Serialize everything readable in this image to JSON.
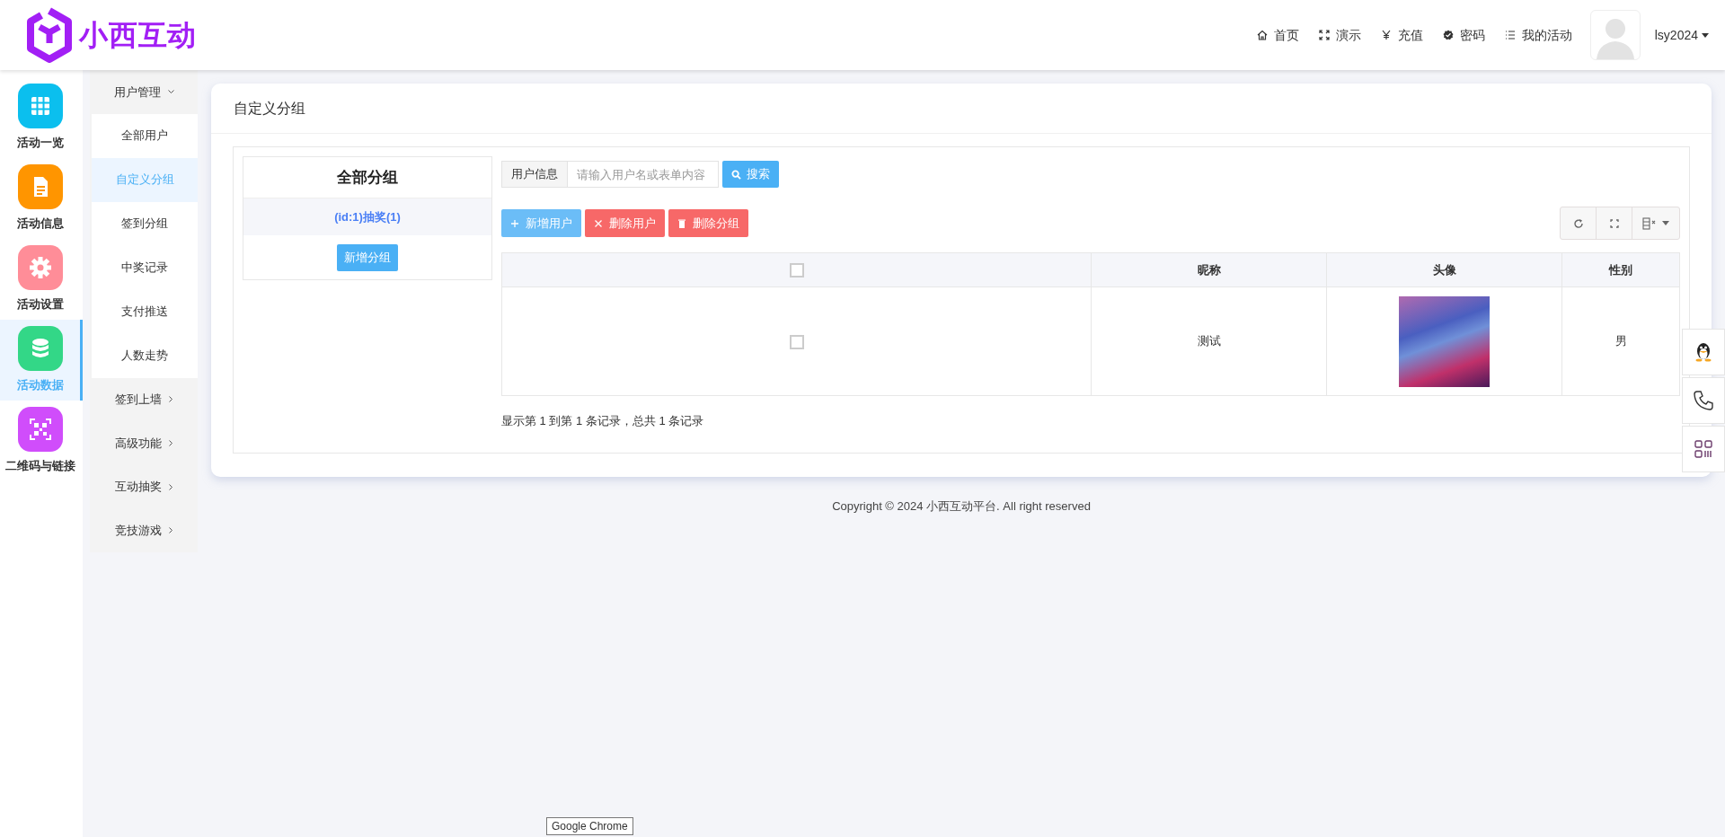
{
  "brand": {
    "name": "小西互动"
  },
  "top_nav": [
    {
      "kind": "home",
      "label": "首页"
    },
    {
      "kind": "expand",
      "label": "演示"
    },
    {
      "kind": "yen",
      "label": "充值"
    },
    {
      "kind": "badge",
      "label": "密码"
    },
    {
      "kind": "list",
      "label": "我的活动"
    }
  ],
  "user": {
    "name": "lsy2024"
  },
  "sidebar": {
    "items": [
      {
        "kind": "grid",
        "label": "活动一览",
        "color": "#0bbfee",
        "selected": false
      },
      {
        "kind": "doc",
        "label": "活动信息",
        "color": "#ff9500",
        "selected": false
      },
      {
        "kind": "gear",
        "label": "活动设置",
        "color": "#ff8d98",
        "selected": false
      },
      {
        "kind": "db",
        "label": "活动数据",
        "color": "#33d787",
        "selected": true
      },
      {
        "kind": "qr",
        "label": "二维码与链接",
        "color": "#d04dfb",
        "selected": false
      }
    ]
  },
  "submenu": [
    {
      "label": "用户管理",
      "expanded": true,
      "children": [
        {
          "label": "全部用户",
          "selected": false
        },
        {
          "label": "自定义分组",
          "selected": true
        },
        {
          "label": "签到分组",
          "selected": false
        },
        {
          "label": "中奖记录",
          "selected": false
        },
        {
          "label": "支付推送",
          "selected": false
        },
        {
          "label": "人数走势",
          "selected": false
        }
      ]
    },
    {
      "label": "签到上墙",
      "expanded": false
    },
    {
      "label": "高级功能",
      "expanded": false
    },
    {
      "label": "互动抽奖",
      "expanded": false
    },
    {
      "label": "竞技游戏",
      "expanded": false
    }
  ],
  "page_title": "自定义分组",
  "groups": {
    "title": "全部分组",
    "items": [
      {
        "label": "(id:1)抽奖(1)",
        "selected": true
      }
    ],
    "add_button": "新增分组"
  },
  "search": {
    "label": "用户信息",
    "placeholder": "请输入用户名或表单内容",
    "button": "搜索"
  },
  "actions": [
    {
      "kind": "add",
      "label": "新增用户"
    },
    {
      "kind": "remove",
      "label": "删除用户"
    },
    {
      "kind": "trash",
      "label": "删除分组"
    }
  ],
  "table": {
    "header_checked": false,
    "columns": [
      "昵称",
      "头像",
      "性别"
    ],
    "rows": [
      {
        "checked": false,
        "nickname": "测试",
        "gender": "男"
      }
    ]
  },
  "pagination": "显示第 1 到第 1 条记录，总共 1 条记录",
  "footer": "Copyright © 2024 小西互动平台. All right reserved",
  "tooltip": "Google Chrome"
}
